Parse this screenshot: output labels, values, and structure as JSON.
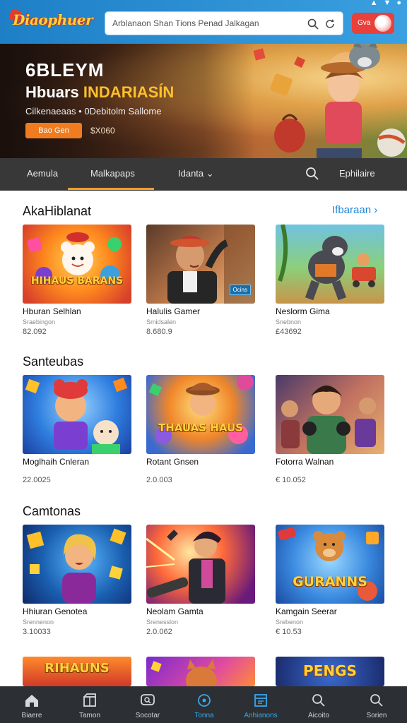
{
  "header": {
    "logo": "Diaophuer",
    "search_text": "Arblanaon Shan   Tions   Penad Jalkagan",
    "login_label": "Gva",
    "status_icons": [
      "signal-icon",
      "wifi-icon",
      "battery-icon"
    ]
  },
  "hero": {
    "title": "6BLEYM",
    "subtitle_prefix": "Hbuars ",
    "subtitle_highlight": "INDARIASÍN",
    "description": "Cilkenaeaas • 0Debitolm Sallome",
    "button_label": "Bao Gen",
    "meta": "$X060"
  },
  "nav": {
    "tabs": [
      "Aemula",
      "Malkapaps",
      "Idanta ⌄"
    ],
    "active_tab": 1,
    "right_label": "Ephilaire"
  },
  "sections": [
    {
      "title": "AkaHiblanat",
      "see_all": "Ifbaraan ›",
      "cards": [
        {
          "title": "Hburan Selhlan",
          "sub": "Sraebingon",
          "value": "82.092"
        },
        {
          "title": "Halulis Gamer",
          "sub": "Smidsalen",
          "value": "8.680.9",
          "badge": "Ocins"
        },
        {
          "title": "Neslorm Gima",
          "sub": "Snebnon",
          "value": "£43692"
        }
      ]
    },
    {
      "title": "Santeubas",
      "see_all": "",
      "cards": [
        {
          "title": "Moglhaih Cnleran",
          "sub": "",
          "value": "22.0025"
        },
        {
          "title": "Rotant Gnsen",
          "sub": "",
          "value": "2.0.003"
        },
        {
          "title": "Fotorra Walnan",
          "sub": "",
          "value": "€ 10.052"
        }
      ]
    },
    {
      "title": "Camtonas",
      "see_all": "",
      "cards": [
        {
          "title": "Hhiuran Genotea",
          "sub": "Srennenon",
          "value": "3.10033"
        },
        {
          "title": "Neolam Gamta",
          "sub": "Srenesslon",
          "value": "2.0.062"
        },
        {
          "title": "Kamgain Seerar",
          "sub": "Srebenon",
          "value": "€ 10.53"
        }
      ]
    }
  ],
  "thumb_texts": {
    "s1c1": "HIHAUS BARANS",
    "s2c2": "THAUAS HAUS",
    "s3c3": "GURANNS",
    "s4c1": "RIHAUNS",
    "s4c3": "PENGS"
  },
  "bottom_nav": {
    "items": [
      {
        "label": "Biaere",
        "icon": "home-icon"
      },
      {
        "label": "Tamon",
        "icon": "box-icon"
      },
      {
        "label": "Socotar",
        "icon": "chat-icon"
      },
      {
        "label": "Tonna",
        "icon": "circle-icon"
      },
      {
        "label": "Anhianons",
        "icon": "calendar-icon"
      },
      {
        "label": "Aicoito",
        "icon": "search-icon"
      },
      {
        "label": "Sorien",
        "icon": "search-icon"
      }
    ],
    "active_index": 4
  },
  "colors": {
    "header": "#2a8fd6",
    "accent": "#f39c2b",
    "link": "#1e86d3",
    "navbar": "#383838",
    "bottomnav": "#2c3034"
  }
}
